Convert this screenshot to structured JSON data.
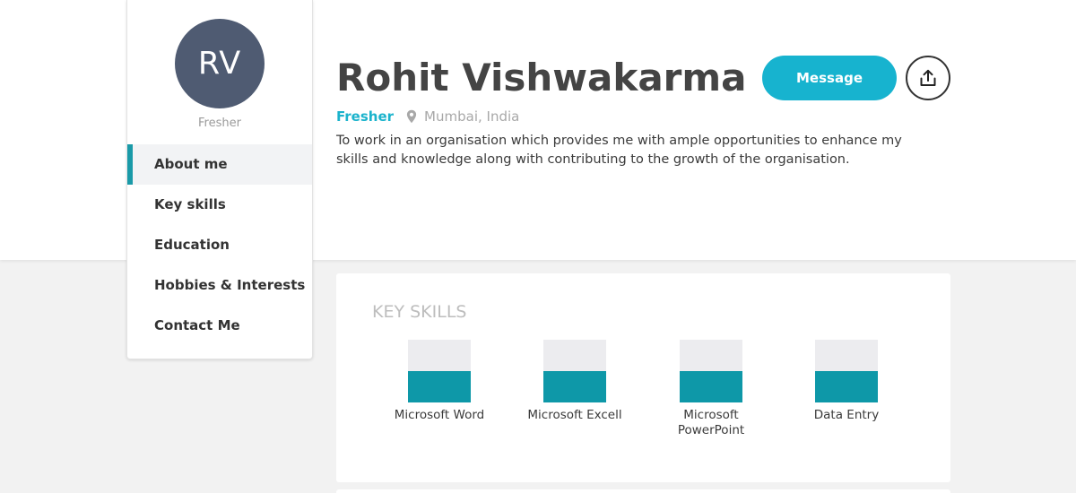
{
  "profile": {
    "initials": "RV",
    "avatar_subtitle": "Fresher",
    "name": "Rohit Vishwakarma",
    "status": "Fresher",
    "location": "Mumbai, India",
    "objective": "To work in an organisation which provides me with ample opportunities to enhance my skills and knowledge along with contributing to the growth of the organisation.",
    "avatar_color": "#4f5b72",
    "accent_color": "#17b3cf"
  },
  "sidebar": {
    "items": [
      {
        "label": "About me",
        "active": true
      },
      {
        "label": "Key skills",
        "active": false
      },
      {
        "label": "Education",
        "active": false
      },
      {
        "label": "Hobbies & Interests",
        "active": false
      },
      {
        "label": "Contact Me",
        "active": false
      }
    ]
  },
  "actions": {
    "message_label": "Message",
    "share_icon": "share-upload-icon"
  },
  "key_skills": {
    "title": "KEY SKILLS",
    "fill_color": "#0e98a8",
    "track_color": "#ececef",
    "items": [
      {
        "label": "Microsoft Word",
        "level": 0.5
      },
      {
        "label": "Microsoft Excell",
        "level": 0.5
      },
      {
        "label": "Microsoft PowerPoint",
        "level": 0.5
      },
      {
        "label": "Data Entry",
        "level": 0.5
      }
    ]
  }
}
